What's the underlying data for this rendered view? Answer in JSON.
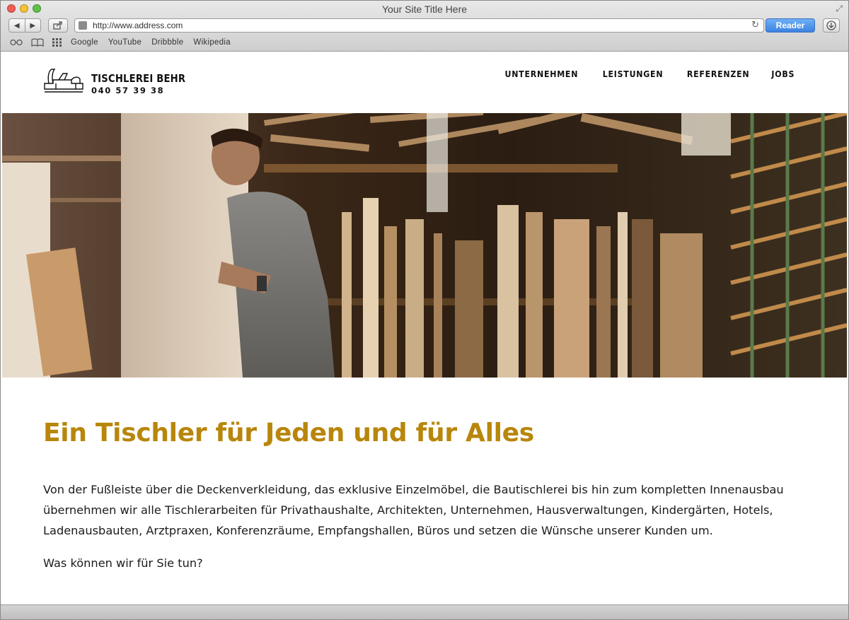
{
  "window": {
    "title": "Your Site Title Here"
  },
  "toolbar": {
    "url": "http://www.address.com",
    "reader_label": "Reader",
    "bookmarks": [
      "Google",
      "YouTube",
      "Dribbble",
      "Wikipedia"
    ]
  },
  "site": {
    "brand": "TISCHLEREI BEHR",
    "phone": "040 57 39 38",
    "nav": [
      "UNTERNEHMEN",
      "LEISTUNGEN",
      "REFERENZEN",
      "JOBS"
    ]
  },
  "main": {
    "headline": "Ein Tischler für Jeden und für Alles",
    "paragraph": "Von der Fußleiste über die Deckenverkleidung, das exklusive Einzelmöbel, die Bautischlerei bis hin zum kompletten Innenausbau übernehmen wir alle Tischlerarbeiten für Privathaushalte, Architekten, Unternehmen, Hausverwaltungen, Kindergärten, Hotels, Ladenausbauten, Arztpraxen, Konferenzräume, Empfangshallen, Büros und setzen die Wünsche unserer Kunden um.",
    "question": "Was können wir für Sie tun?"
  },
  "colors": {
    "accent": "#b8860b",
    "reader": "#3c82e0"
  }
}
